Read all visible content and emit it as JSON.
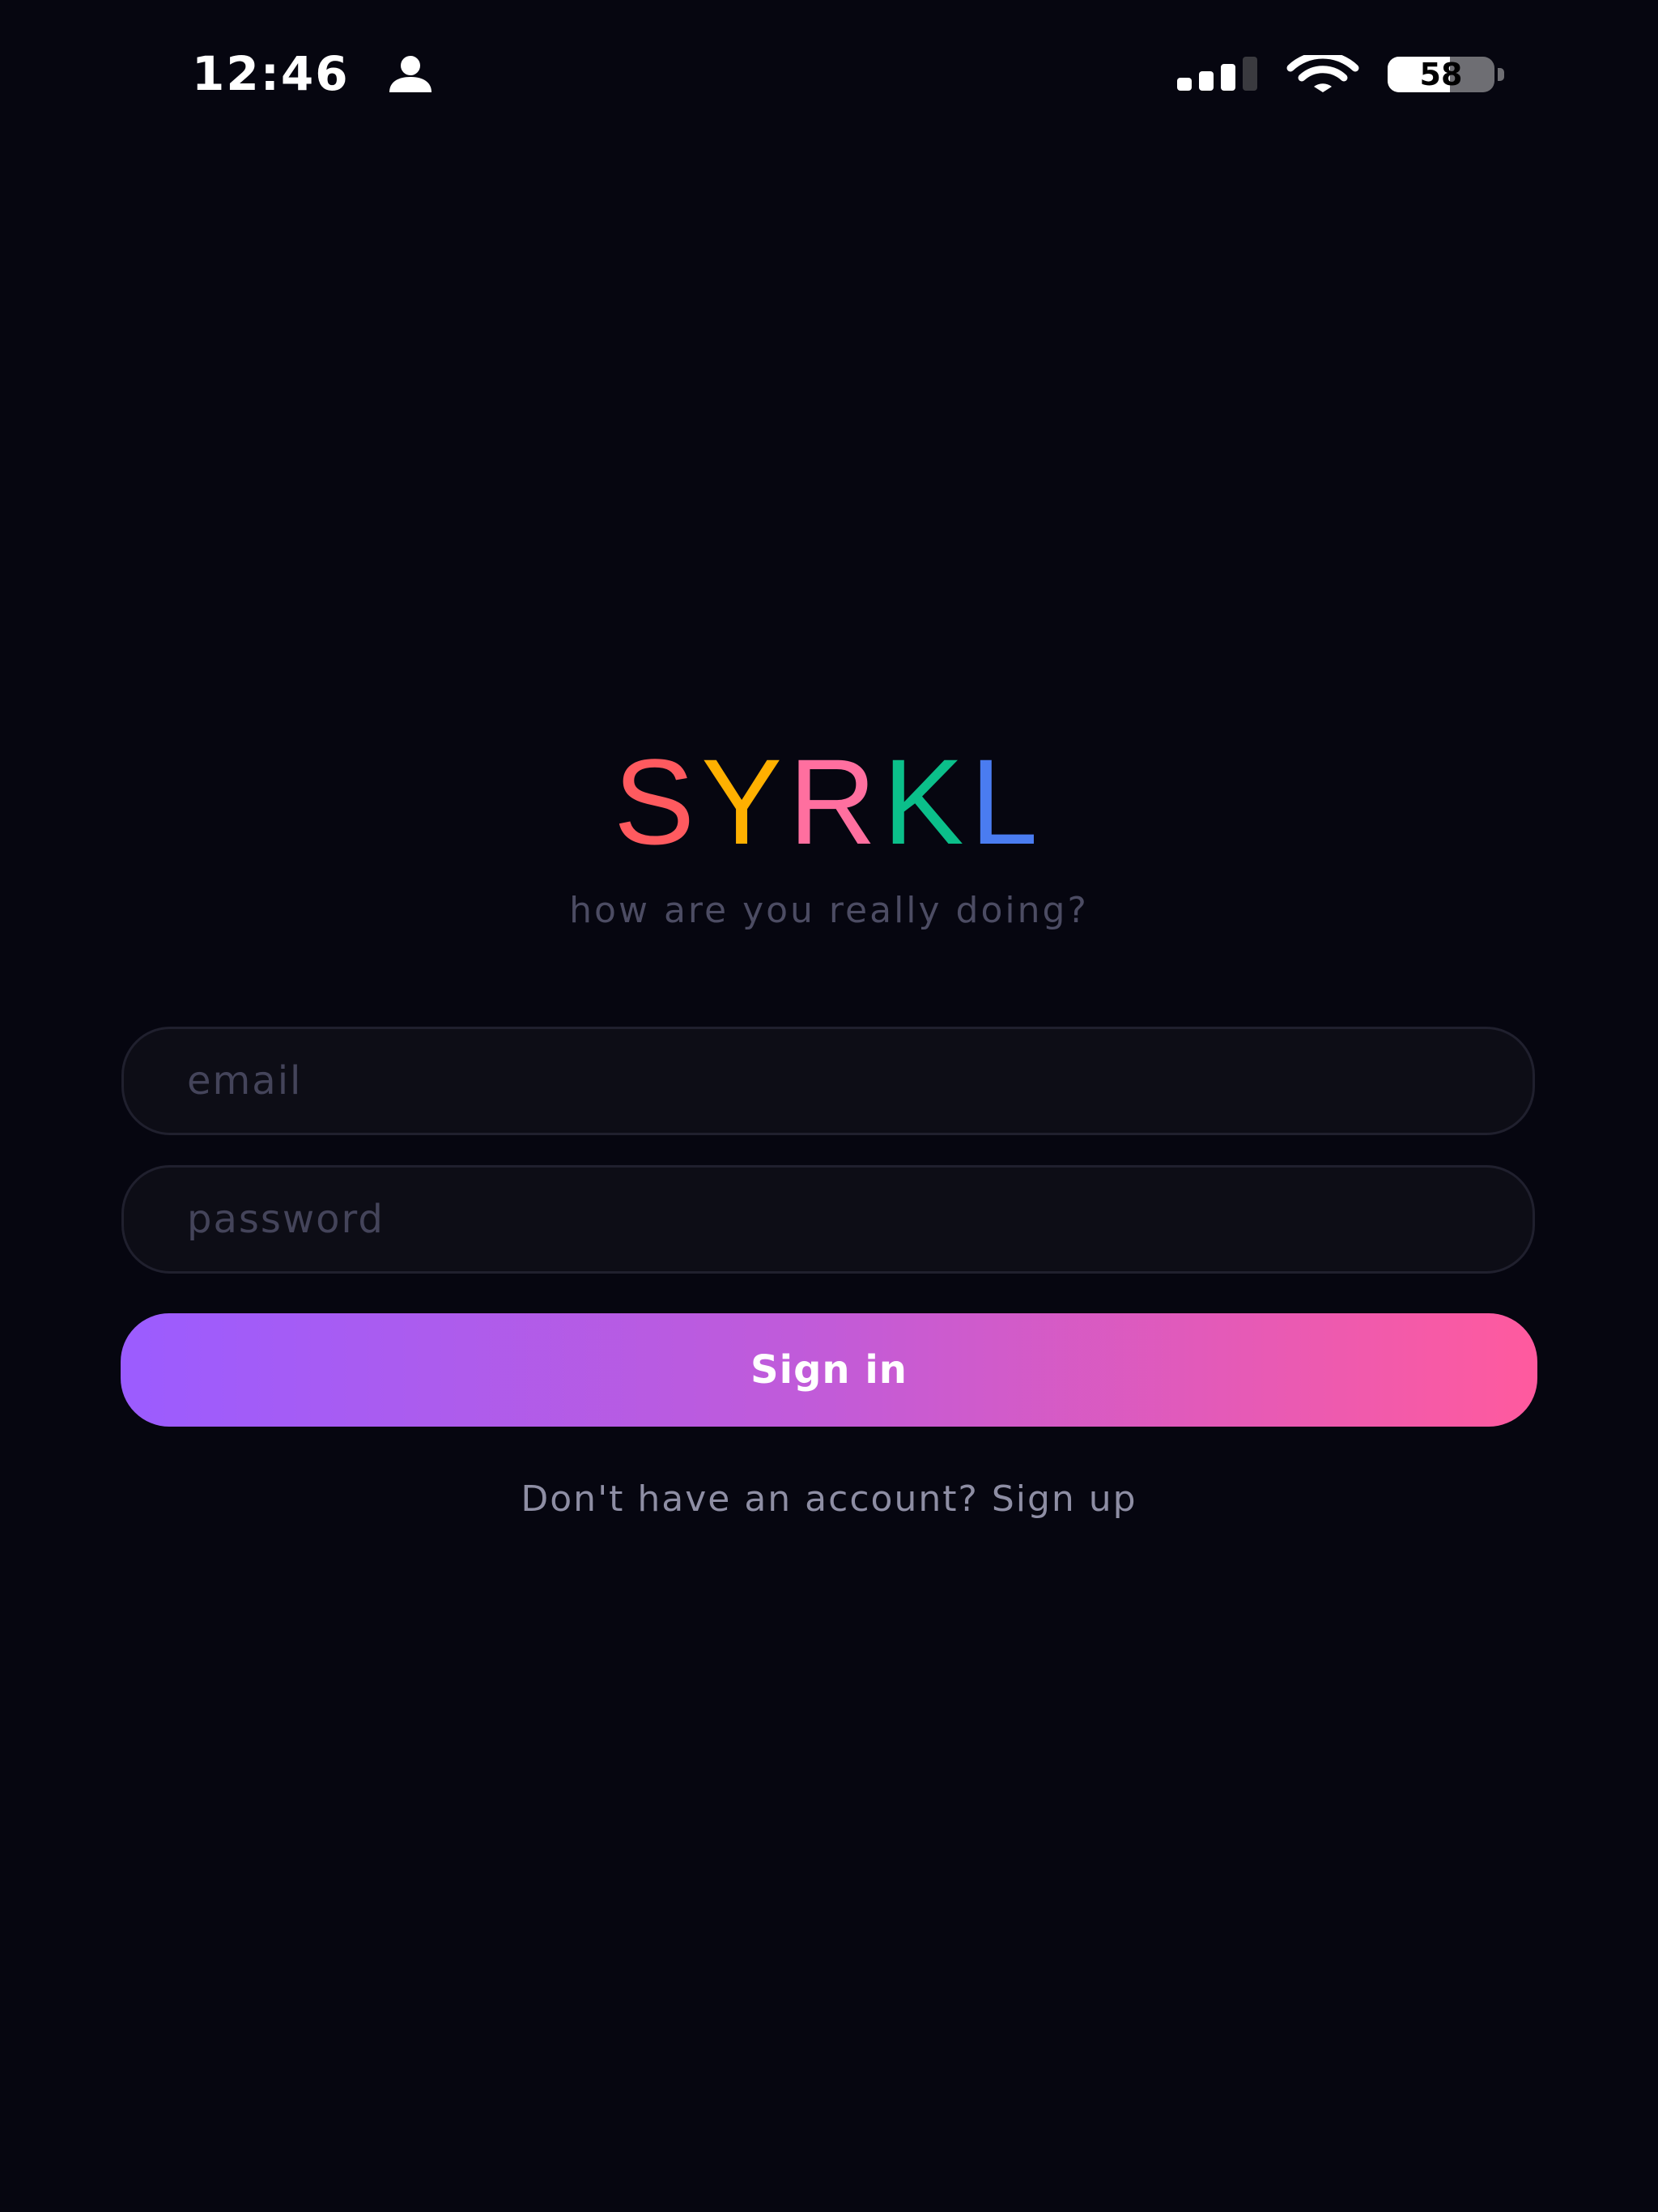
{
  "status_bar": {
    "time": "12:46",
    "battery_level": 58,
    "battery_text": "58",
    "icons": [
      "person-icon",
      "cellular-signal-icon",
      "wifi-icon",
      "battery-icon"
    ]
  },
  "brand": {
    "letters": [
      {
        "char": "S",
        "color": "#ff5a5f"
      },
      {
        "char": "Y",
        "color": "#ffb000"
      },
      {
        "char": "R",
        "color": "#ff6f9f"
      },
      {
        "char": "K",
        "color": "#0bbf8a"
      },
      {
        "char": "L",
        "color": "#4a7cf0"
      }
    ],
    "tagline": "how are you really doing?"
  },
  "form": {
    "email_placeholder": "email",
    "email_value": "",
    "password_placeholder": "password",
    "password_value": "",
    "sign_in_label": "Sign in"
  },
  "signup": {
    "prompt": "Don't have an account?",
    "link_label": "Sign up"
  },
  "colors": {
    "background": "#060610",
    "button_gradient_start": "#9b5cff",
    "button_gradient_end": "#ff5a9e",
    "tagline": "#4c4c63",
    "muted_text": "#8e8ea4"
  }
}
